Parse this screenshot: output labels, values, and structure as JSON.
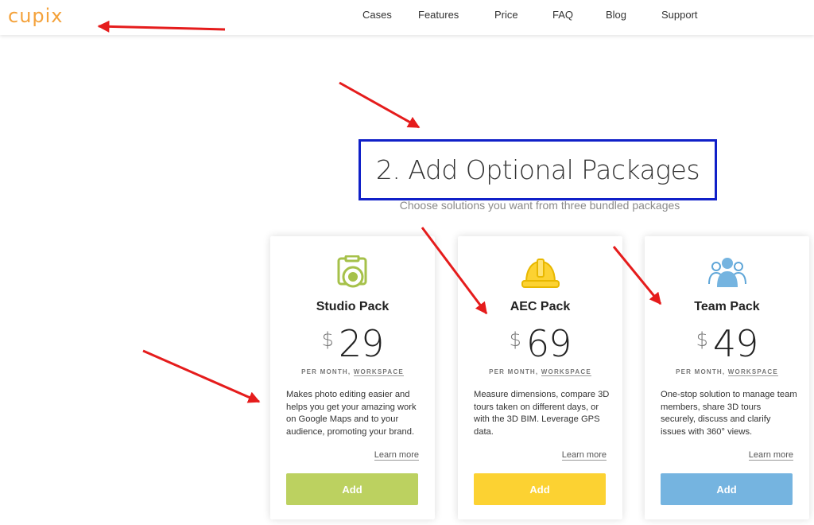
{
  "brand": {
    "logo": "cupix",
    "color": "#f4a23b"
  },
  "nav": [
    "Cases",
    "Features",
    "Price",
    "FAQ",
    "Blog",
    "Support"
  ],
  "section": {
    "title": "2. Add Optional Packages",
    "subtitle": "Choose solutions you want from three bundled packages"
  },
  "cards": [
    {
      "icon": "camera-icon",
      "name": "Studio Pack",
      "currency": "$",
      "price": "29",
      "period_prefix": "PER MONTH, ",
      "period_suffix": "WORKSPACE",
      "description": "Makes photo editing easier and helps you get your amazing work on Google Maps and to your audience, promoting your brand.",
      "learn_more": "Learn more",
      "button": "Add",
      "button_color": "#bcd160"
    },
    {
      "icon": "hard-hat-icon",
      "name": "AEC Pack",
      "currency": "$",
      "price": "69",
      "period_prefix": "PER MONTH, ",
      "period_suffix": "WORKSPACE",
      "description": "Measure dimensions, compare 3D tours taken on different days, or with the 3D BIM. Leverage GPS data.",
      "learn_more": "Learn more",
      "button": "Add",
      "button_color": "#fcd232"
    },
    {
      "icon": "team-icon",
      "name": "Team Pack",
      "currency": "$",
      "price": "49",
      "period_prefix": "PER MONTH, ",
      "period_suffix": "WORKSPACE",
      "description": "One-stop solution to manage team members, share 3D tours securely, discuss and clarify issues with 360° views.",
      "learn_more": "Learn more",
      "button": "Add",
      "button_color": "#75b4e0"
    }
  ],
  "annotations": {
    "arrow_color": "#e51c1c",
    "box_color": "#1020c8"
  }
}
